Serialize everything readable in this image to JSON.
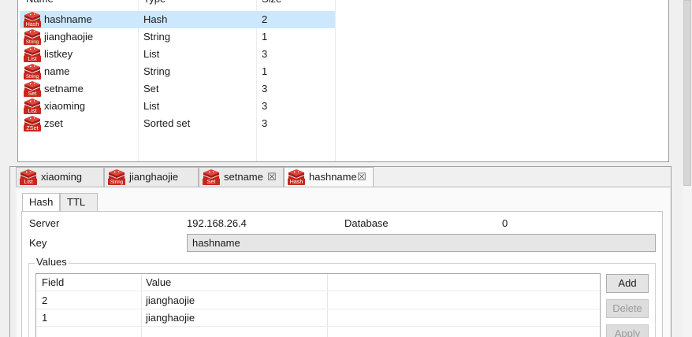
{
  "key_table": {
    "columns": [
      "Name",
      "Type",
      "Size"
    ],
    "rows": [
      {
        "name": "hashname",
        "type": "Hash",
        "size": "2",
        "icon": "Hash",
        "selected": true
      },
      {
        "name": "jianghaojie",
        "type": "String",
        "size": "1",
        "icon": "String",
        "selected": false
      },
      {
        "name": "listkey",
        "type": "List",
        "size": "3",
        "icon": "List",
        "selected": false
      },
      {
        "name": "name",
        "type": "String",
        "size": "1",
        "icon": "String",
        "selected": false
      },
      {
        "name": "setname",
        "type": "Set",
        "size": "3",
        "icon": "Set",
        "selected": false
      },
      {
        "name": "xiaoming",
        "type": "List",
        "size": "3",
        "icon": "List",
        "selected": false
      },
      {
        "name": "zset",
        "type": "Sorted set",
        "size": "3",
        "icon": "ZSet",
        "selected": false
      }
    ]
  },
  "editor_tabs": [
    {
      "label": "xiaoming",
      "icon": "List",
      "closable": false,
      "active": false
    },
    {
      "label": "jianghaojie",
      "icon": "String",
      "closable": false,
      "active": false
    },
    {
      "label": "setname",
      "icon": "Set",
      "closable": true,
      "active": false
    },
    {
      "label": "hashname",
      "icon": "Hash",
      "closable": true,
      "active": true
    }
  ],
  "close_glyph": "☒",
  "inner_tabs": [
    {
      "label": "Hash",
      "active": true
    },
    {
      "label": "TTL",
      "active": false
    }
  ],
  "detail": {
    "server_label": "Server",
    "server_value": "192.168.26.4",
    "database_label": "Database",
    "database_value": "0",
    "key_label": "Key",
    "key_value": "hashname",
    "values_label": "Values"
  },
  "values_table": {
    "columns": [
      "Field",
      "Value"
    ],
    "rows": [
      {
        "field": "2",
        "value": "jianghaojie"
      },
      {
        "field": "1",
        "value": "jianghaojie"
      }
    ]
  },
  "buttons": {
    "add": "Add",
    "delete": "Delete",
    "apply": "Apply"
  },
  "colors": {
    "selection": "#cce8ff",
    "redis_red": "#c8281e"
  }
}
